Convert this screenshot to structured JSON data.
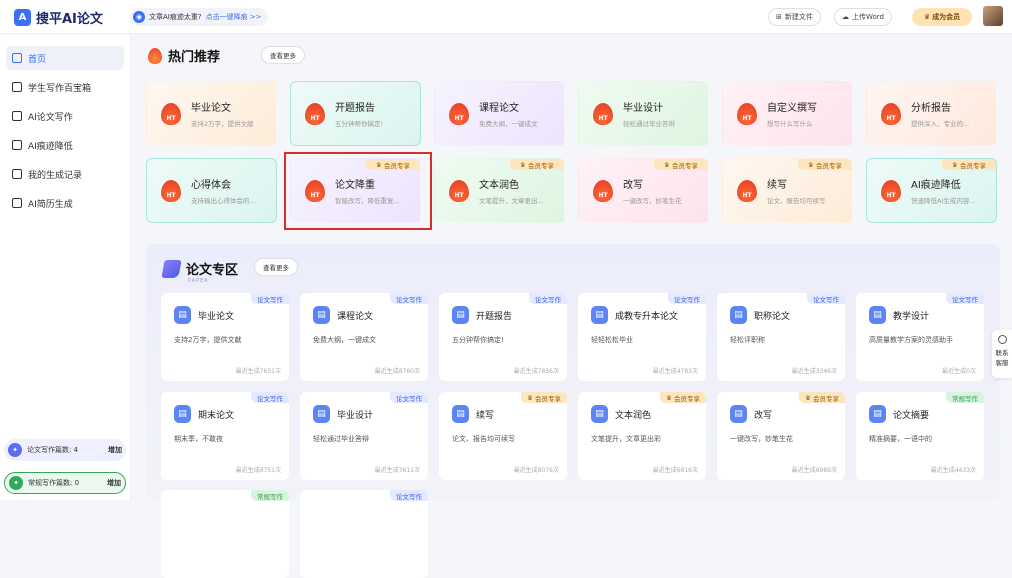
{
  "brand": {
    "name": "搜平AI论文",
    "mark": "A"
  },
  "notice": {
    "text": "文章AI痕迹太重?",
    "link": "点击一键降痕 >>"
  },
  "header": {
    "new_file": "新建文件",
    "upload_word": "上传Word",
    "vip": "成为会员"
  },
  "sidebar": {
    "items": [
      {
        "label": "首页",
        "icon": "home-icon",
        "active": true
      },
      {
        "label": "学生写作百宝箱",
        "icon": "toolbox-icon"
      },
      {
        "label": "AI论文写作",
        "icon": "paper-icon"
      },
      {
        "label": "AI痕迹降低",
        "icon": "reduce-icon"
      },
      {
        "label": "我的生成记录",
        "icon": "record-icon"
      },
      {
        "label": "AI简历生成",
        "icon": "resume-icon"
      }
    ],
    "paper_quota": {
      "label": "论文写作篇数:",
      "value": "4",
      "action": "增加"
    },
    "regular_quota": {
      "label": "常规写作篇数:",
      "value": "0",
      "action": "增加"
    }
  },
  "hot": {
    "title": "热门推荐",
    "more": "查看更多",
    "vip_badge": "会员专享",
    "ht_text": "HT",
    "cards": [
      {
        "title": "毕业论文",
        "desc": "支持2万字，提供文献"
      },
      {
        "title": "开题报告",
        "desc": "五分钟帮你搞定!"
      },
      {
        "title": "课程论文",
        "desc": "免费大纲，一键成文"
      },
      {
        "title": "毕业设计",
        "desc": "轻松通过毕业答辩"
      },
      {
        "title": "自定义撰写",
        "desc": "想写什么写什么"
      },
      {
        "title": "分析报告",
        "desc": "提供深入、专业的..."
      },
      {
        "title": "心得体会",
        "desc": "支持输出心得体会的..."
      },
      {
        "title": "论文降重",
        "desc": "智能改写，降低重复..."
      },
      {
        "title": "文本润色",
        "desc": "文笔提升，文章更出..."
      },
      {
        "title": "改写",
        "desc": "一键改写，妙笔生花"
      },
      {
        "title": "续写",
        "desc": "论文、报告均可续写"
      },
      {
        "title": "AI痕迹降低",
        "desc": "快速降低AI生成内容..."
      }
    ]
  },
  "paper": {
    "title": "论文专区",
    "subtitle": "PAPER",
    "more": "查看更多",
    "cards": [
      {
        "title": "毕业论文",
        "desc": "支持2万字，提供文献",
        "count": "最近生成7651次",
        "tag": "论文写作"
      },
      {
        "title": "课程论文",
        "desc": "免费大纲，一键成文",
        "count": "最近生成8760次",
        "tag": "论文写作"
      },
      {
        "title": "开题报告",
        "desc": "五分钟帮你搞定!",
        "count": "最近生成7856次",
        "tag": "论文写作"
      },
      {
        "title": "成教专升本论文",
        "desc": "轻轻松松毕业",
        "count": "最近生成4783次",
        "tag": "论文写作"
      },
      {
        "title": "职称论文",
        "desc": "轻松评职称",
        "count": "最近生成3346次",
        "tag": "论文写作"
      },
      {
        "title": "教学设计",
        "desc": "高质量教学方案的灵感助手",
        "count": "最近生成0次",
        "tag": "论文写作"
      },
      {
        "title": "期末论文",
        "desc": "期末季，不敢夜",
        "count": "最近生成6751次",
        "tag": "论文写作"
      },
      {
        "title": "毕业设计",
        "desc": "轻松通过毕业答辩",
        "count": "最近生成7611次",
        "tag": "论文写作"
      },
      {
        "title": "续写",
        "desc": "论文、报告均可续写",
        "count": "最近生成8076次",
        "tag": "会员专享"
      },
      {
        "title": "文本润色",
        "desc": "文笔提升，文章更出彩",
        "count": "最近生成6816次",
        "tag": "会员专享"
      },
      {
        "title": "改写",
        "desc": "一键改写，妙笔生花",
        "count": "最近生成6989次",
        "tag": "会员专享"
      },
      {
        "title": "论文摘要",
        "desc": "精准摘要，一语中的",
        "count": "最近生成4433次",
        "tag": "常规写作"
      }
    ],
    "partial_tags": [
      "常规写作",
      "论文写作"
    ]
  },
  "float": {
    "label1": "联系",
    "label2": "客服"
  }
}
